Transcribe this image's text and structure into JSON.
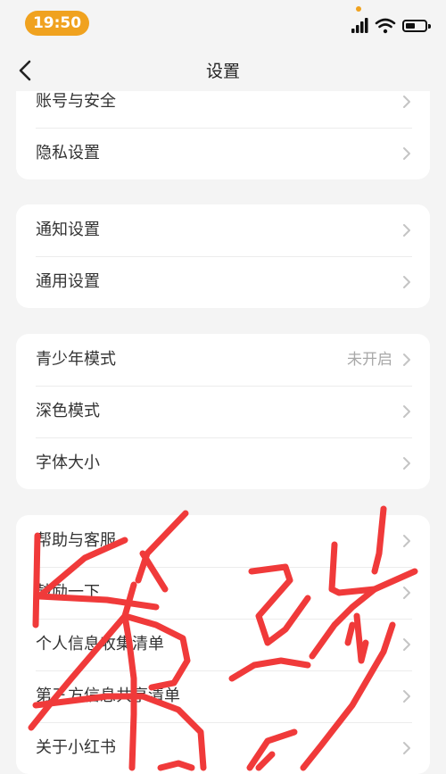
{
  "status": {
    "time": "19:50"
  },
  "nav": {
    "title": "设置",
    "back_icon": "chevron-left-icon"
  },
  "groups": [
    {
      "items": [
        {
          "label": "账号与安全"
        },
        {
          "label": "隐私设置"
        }
      ]
    },
    {
      "items": [
        {
          "label": "通知设置"
        },
        {
          "label": "通用设置"
        }
      ]
    },
    {
      "items": [
        {
          "label": "青少年模式",
          "value": "未开启"
        },
        {
          "label": "深色模式"
        },
        {
          "label": "字体大小"
        }
      ]
    },
    {
      "items": [
        {
          "label": "帮助与客服"
        },
        {
          "label": "鼓励一下"
        },
        {
          "label": "个人信息收集清单"
        },
        {
          "label": "第三方信息共享清单"
        },
        {
          "label": "关于小红书"
        }
      ]
    }
  ],
  "colors": {
    "accent": "#f0a21f",
    "background": "#f4f4f4",
    "scribble": "#f03a3a"
  }
}
